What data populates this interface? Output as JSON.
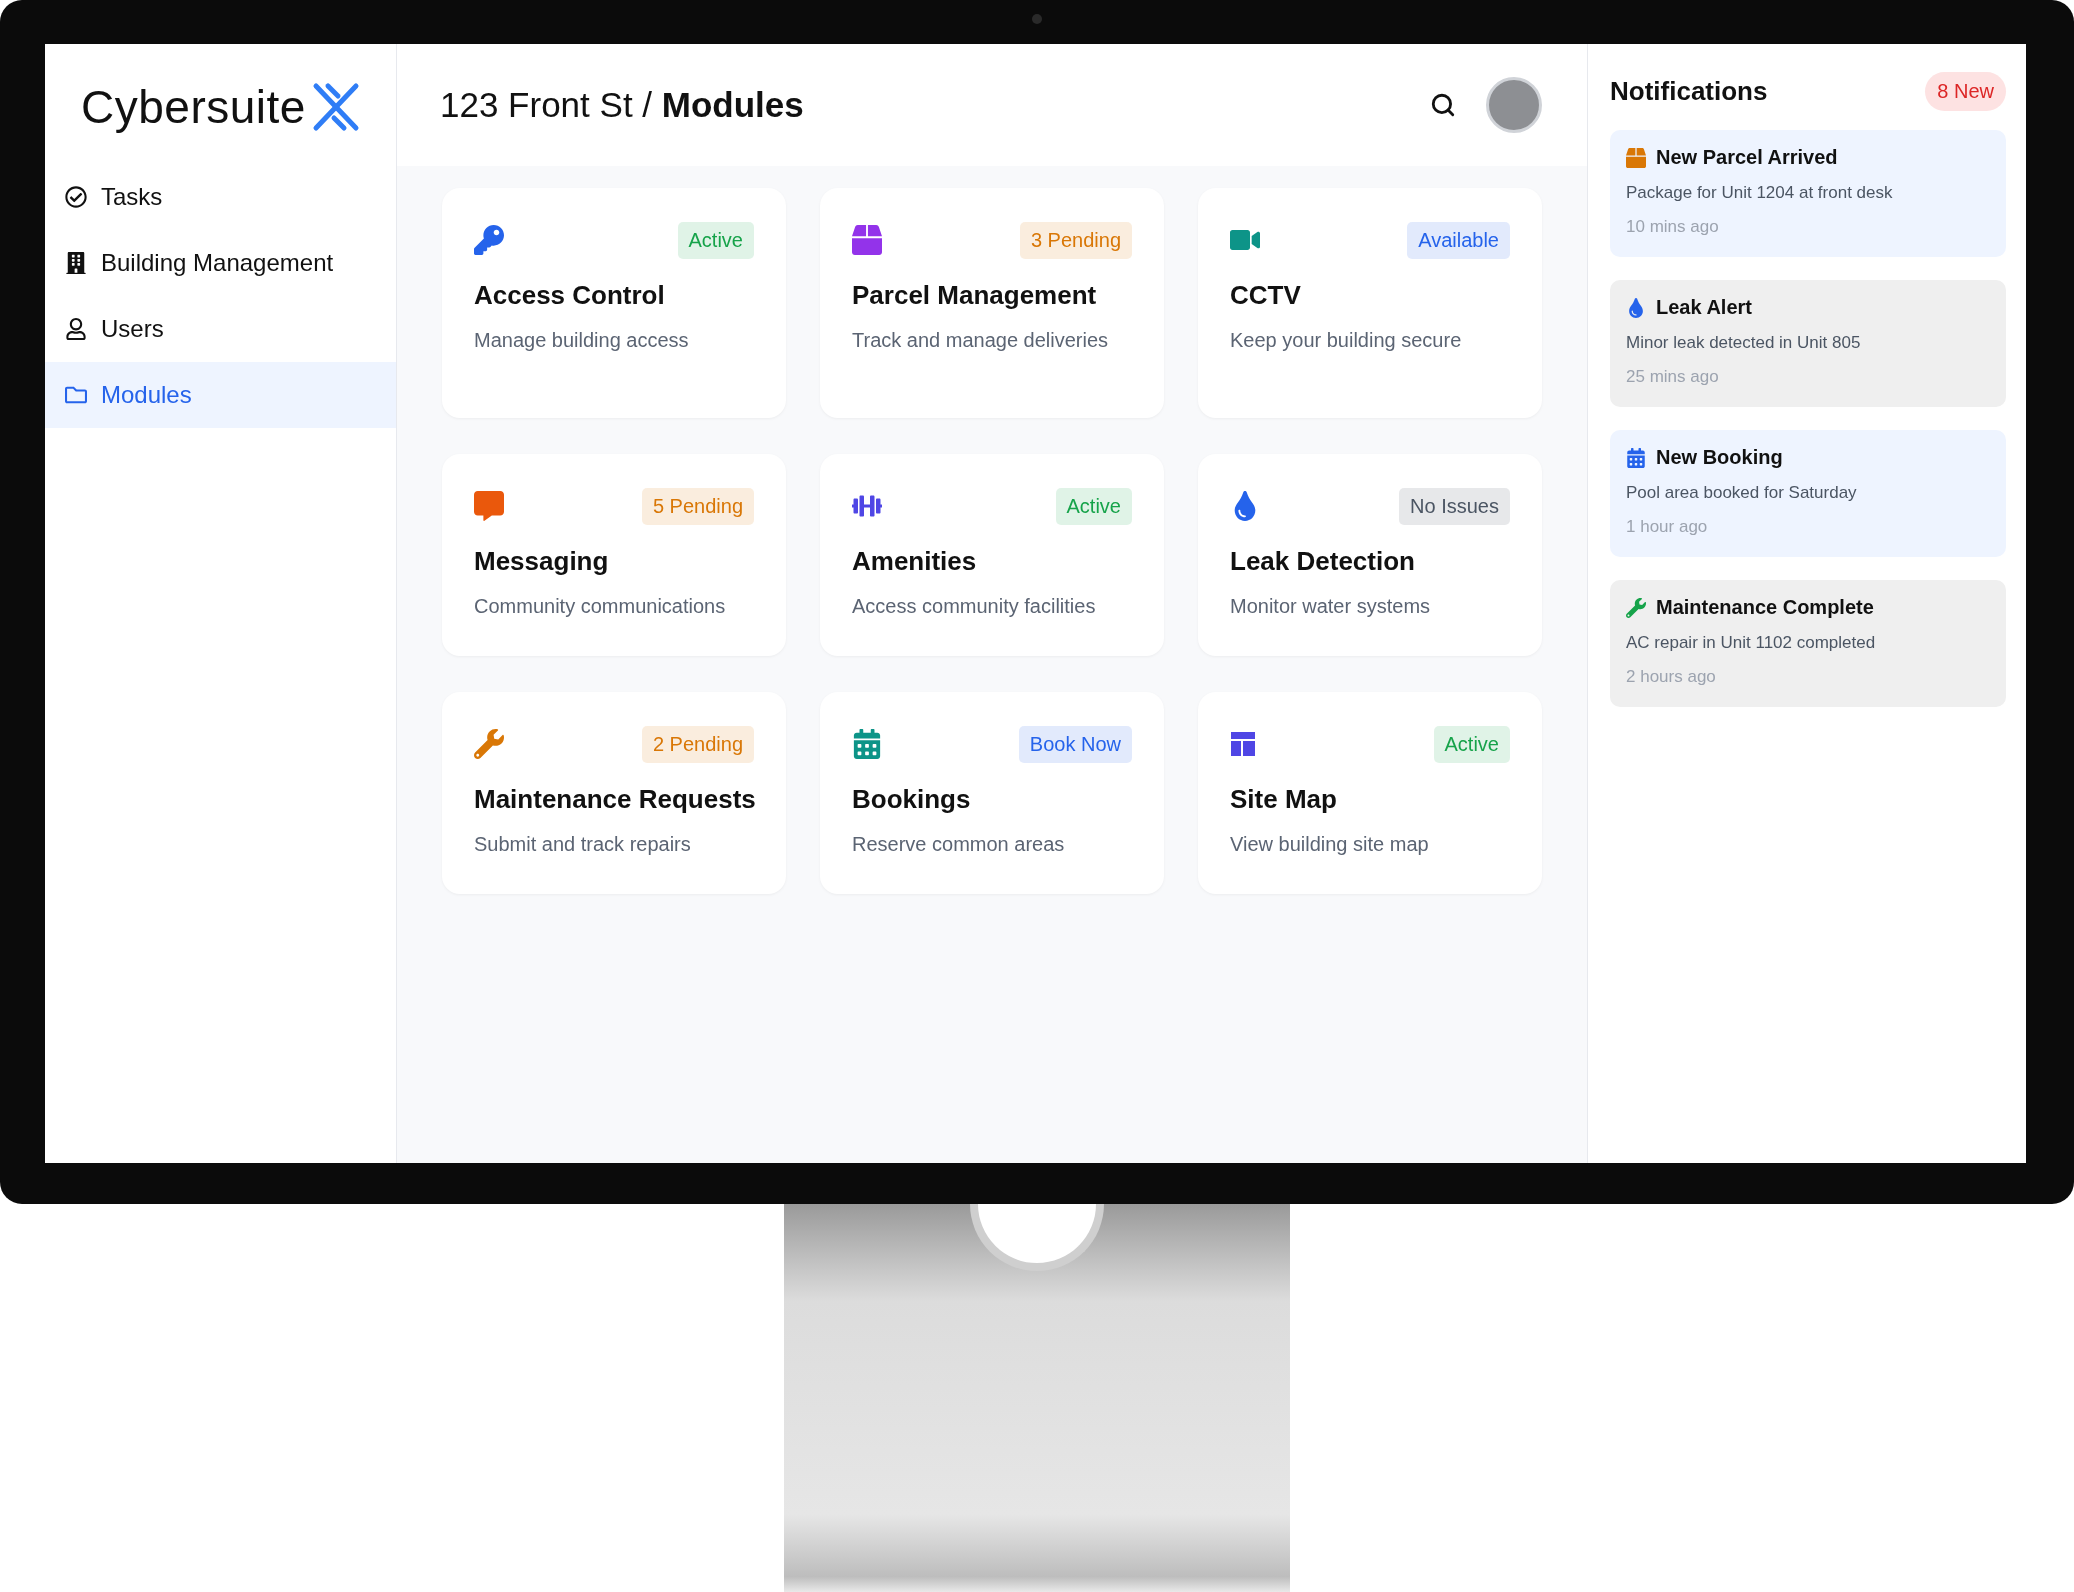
{
  "sidebar": {
    "logo": "Cybersuite",
    "items": [
      {
        "label": "Tasks",
        "selected": false
      },
      {
        "label": "Building Management",
        "selected": false
      },
      {
        "label": "Users",
        "selected": false
      },
      {
        "label": "Modules",
        "selected": true
      }
    ]
  },
  "header": {
    "location": "123 Front St / ",
    "page": "Modules"
  },
  "modules": [
    {
      "title": "Access Control",
      "description": "Manage building access",
      "status": {
        "text": "Active",
        "color": "#16a34a"
      }
    },
    {
      "title": "Parcel Management",
      "description": "Track and manage deliveries",
      "status": {
        "text": "3 Pending",
        "color": "#d97706"
      }
    },
    {
      "title": "CCTV",
      "description": "Keep your building secure",
      "status": {
        "text": "Available",
        "color": "#2563eb"
      }
    },
    {
      "title": "Messaging",
      "description": "Community communications",
      "status": {
        "text": "5 Pending",
        "color": "#d97706"
      }
    },
    {
      "title": "Amenities",
      "description": "Access community facilities",
      "status": {
        "text": "Active",
        "color": "#16a34a"
      }
    },
    {
      "title": "Leak Detection",
      "description": "Monitor water systems",
      "status": {
        "text": "No Issues",
        "color": "#4b5563"
      }
    },
    {
      "title": "Maintenance Requests",
      "description": "Submit and track repairs",
      "status": {
        "text": "2 Pending",
        "color": "#d97706"
      }
    },
    {
      "title": "Bookings",
      "description": "Reserve common areas",
      "status": {
        "text": "Book Now",
        "color": "#2563eb"
      }
    },
    {
      "title": "Site Map",
      "description": "View building site map",
      "status": {
        "text": "Active",
        "color": "#16a34a"
      }
    }
  ],
  "notifications": {
    "title": "Notifications",
    "badge": "8 New",
    "items": [
      {
        "title": "New Parcel Arrived",
        "body": "Package for Unit 1204 at front desk",
        "time": "10 mins ago",
        "unread": true
      },
      {
        "title": "Leak Alert",
        "body": "Minor leak detected in Unit 805",
        "time": "25 mins ago",
        "unread": false
      },
      {
        "title": "New Booking",
        "body": "Pool area booked for Saturday",
        "time": "1 hour ago",
        "unread": true
      },
      {
        "title": "Maintenance Complete",
        "body": "AC repair in Unit 1102 completed",
        "time": "2 hours ago",
        "unread": false
      }
    ]
  }
}
